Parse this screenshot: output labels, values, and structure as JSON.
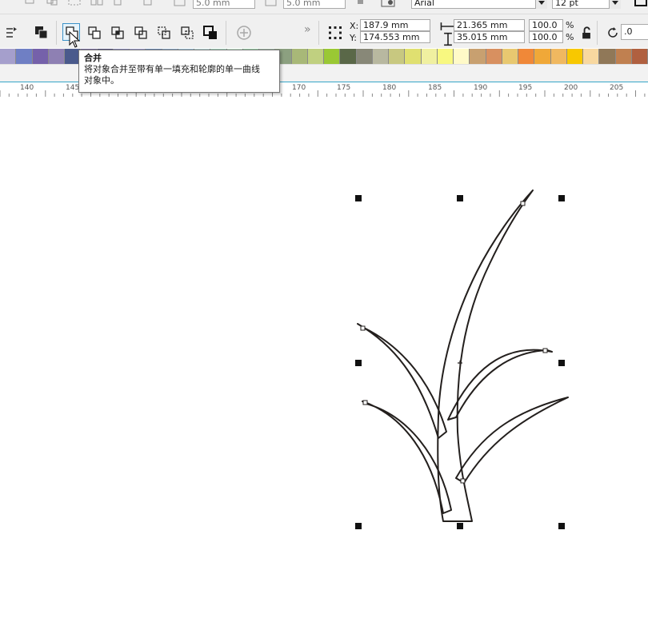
{
  "property_bar_top": {
    "size_a": "5.0 mm",
    "size_b": "5.0 mm",
    "font_name": "Arial",
    "font_size": "12 pt"
  },
  "property_bar": {
    "x_label": "X:",
    "x_value": "187.9 mm",
    "y_label": "Y:",
    "y_value": "174.553 mm",
    "width_value": "21.365 mm",
    "height_value": "35.015 mm",
    "scale_x": "100.0",
    "scale_y": "100.0",
    "percent": "%",
    "rotation": ".0",
    "more": "»"
  },
  "tooltip": {
    "title": "合并",
    "body_line1": "将对象合并至带有单一填充和轮廓的单一曲线",
    "body_line2": "对象中。"
  },
  "ruler": {
    "labels": [
      "140",
      "145",
      "170",
      "175",
      "180",
      "185",
      "190",
      "195",
      "200",
      "205"
    ]
  },
  "palette": {
    "colors": [
      "#a59fcc",
      "#6f7fc4",
      "#7561aa",
      "#8e80b3",
      "#4a5a8c",
      "#7a6e9e",
      "#5c5784",
      "#8a8ab8",
      "#9b9bcc",
      "#6f8fb8",
      "#8aa8c8",
      "#9cc0d8",
      "#b8d8d8",
      "#a8d8c0",
      "#c8e8d0",
      "#9ad0a8",
      "#9ab0a0",
      "#8ca080",
      "#a8b878",
      "#c0d080",
      "#9ac834",
      "#5a6848",
      "#888878",
      "#b8b8a0",
      "#c8c880",
      "#e0e070",
      "#f0f0a0",
      "#f8f880",
      "#fffac8",
      "#c8a070",
      "#d89060",
      "#e8c870",
      "#f08838",
      "#f0a838",
      "#f0b860",
      "#f8c800",
      "#f8d8a0",
      "#907858",
      "#c08050",
      "#b06040"
    ]
  },
  "icons": {
    "toolbar": [
      "order-icon",
      "combine-icon",
      "weld-icon",
      "trim-icon",
      "intersect-icon",
      "simplify-icon",
      "front-minus-back-icon",
      "back-minus-front-icon",
      "boundary-icon",
      "add-icon",
      "position-grid-icon",
      "lock-ratio-icon",
      "rotate-icon"
    ]
  }
}
